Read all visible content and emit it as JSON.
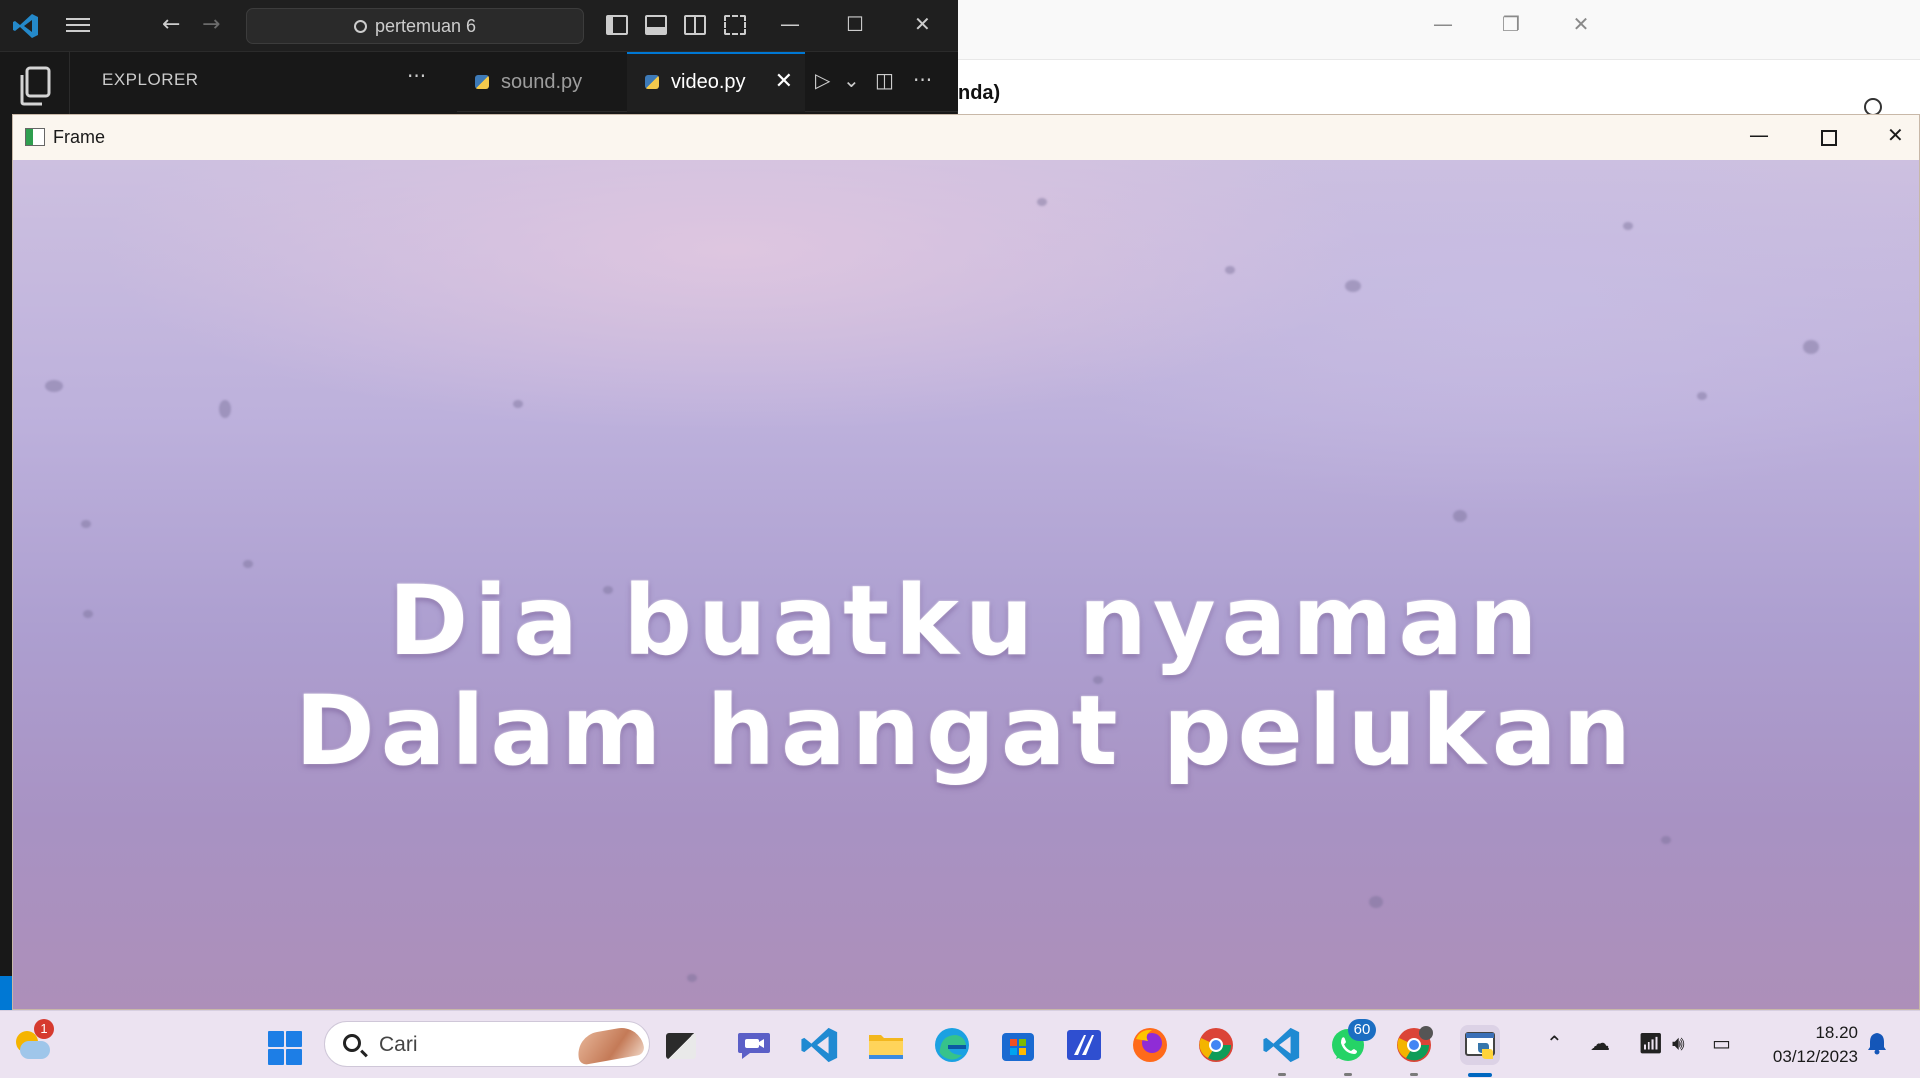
{
  "vscode": {
    "search_text": "pertemuan 6",
    "explorer_title": "EXPLORER",
    "more_label": "···",
    "tabs": [
      {
        "label": "sound.py",
        "active": false
      },
      {
        "label": "video.py",
        "active": true
      }
    ],
    "close_label": "✕",
    "run_label": "▷",
    "dropdown_label": "⌄",
    "accent": "#0078d4"
  },
  "background_window": {
    "visible_text": "nda)"
  },
  "frame": {
    "title": "Frame",
    "lyrics": [
      "Dia buatku nyaman",
      "Dalam hangat pelukan"
    ]
  },
  "taskbar": {
    "weather_badge": "1",
    "search_placeholder": "Cari",
    "pinned_apps": [
      "task-view-icon",
      "teams-icon",
      "vscode-icon",
      "file-explorer-icon",
      "edge-icon",
      "microsoft-store-icon",
      "ai-app-icon",
      "firefox-icon",
      "chrome-icon",
      "vscode-icon",
      "whatsapp-icon",
      "chrome-profile-icon",
      "python-icon"
    ],
    "whatsapp_badge": "60",
    "time": "18.20",
    "date": "03/12/2023"
  }
}
